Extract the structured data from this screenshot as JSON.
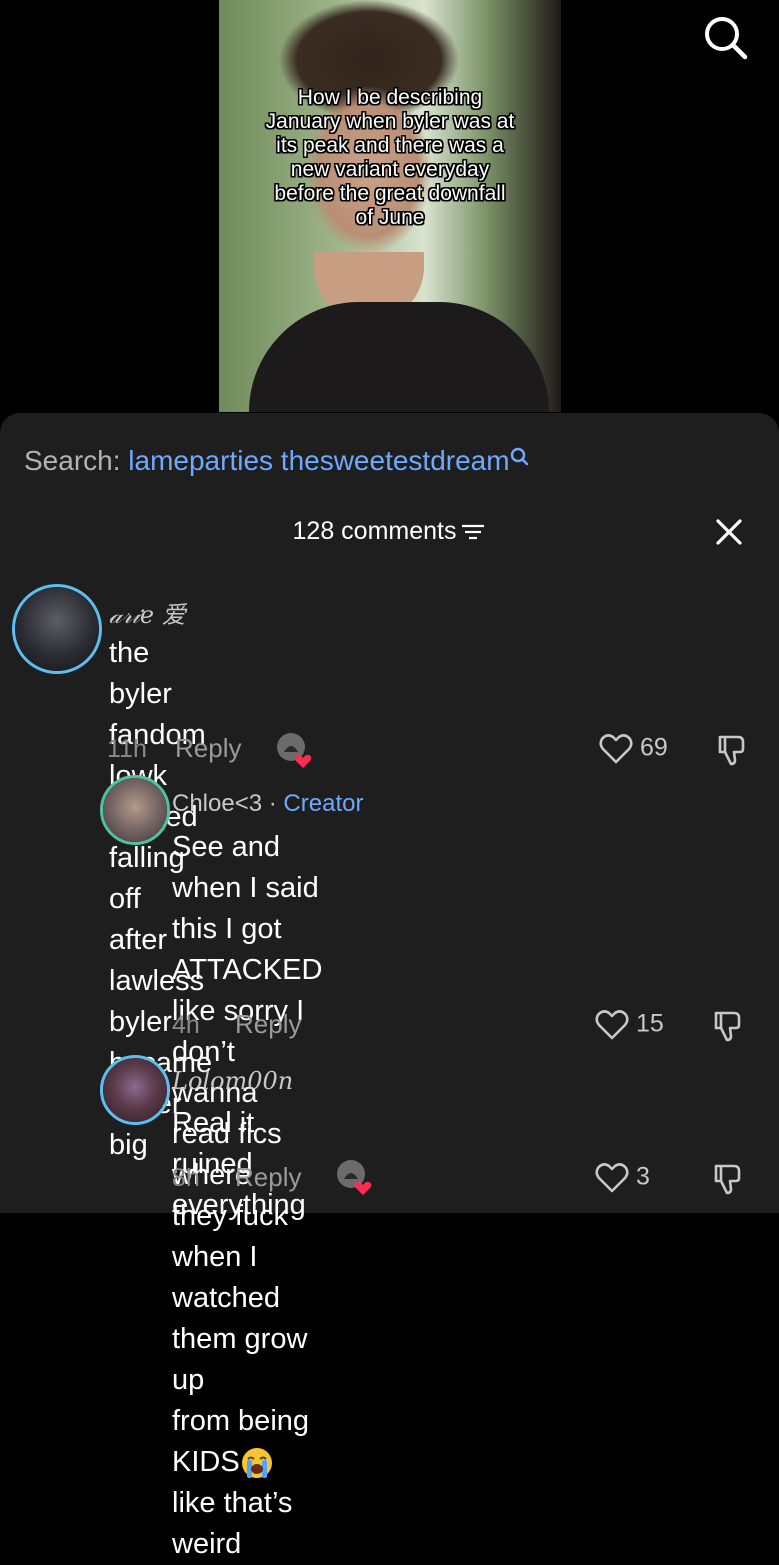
{
  "video": {
    "caption_lines": [
      "How I be describing",
      "January when byler was at",
      "its peak and there was a",
      "new variant everyday",
      "before the great downfall",
      "of June"
    ]
  },
  "search_icon": "search-icon",
  "sheet": {
    "search_label": "Search:",
    "search_query": "lameparties thesweetestdream",
    "comment_count": "128 comments",
    "close_icon": "close-icon"
  },
  "comments": [
    {
      "username": "𝒶𝓇𝒾𝑒 爱",
      "text_lines": [
        "the byler fandom lowk started falling off",
        "after lawless byler became super big"
      ],
      "time": "11h",
      "reply_label": "Reply",
      "likes": "69",
      "creator_liked": true
    },
    {
      "username": "Chloe<3",
      "dot": "·",
      "badge": "Creator",
      "text_lines": [
        "See and when I said this I got ATTACKED",
        "like sorry I don’t wanna read fics where",
        "they fuck when I watched them grow up",
        "from being KIDS",
        "like that’s weird"
      ],
      "time": "4h",
      "reply_label": "Reply",
      "likes": "15",
      "creator_liked": false
    },
    {
      "username": "Lolom00n",
      "text_lines": [
        "Real it ruined everything"
      ],
      "time": "8h",
      "reply_label": "Reply",
      "likes": "3",
      "creator_liked": true
    }
  ],
  "colors": {
    "accent_blue": "#6fa8ff",
    "sheet_bg": "#1e1e1e",
    "avatar_ring": "#5bc0f0",
    "heart_red": "#ff2d55"
  }
}
